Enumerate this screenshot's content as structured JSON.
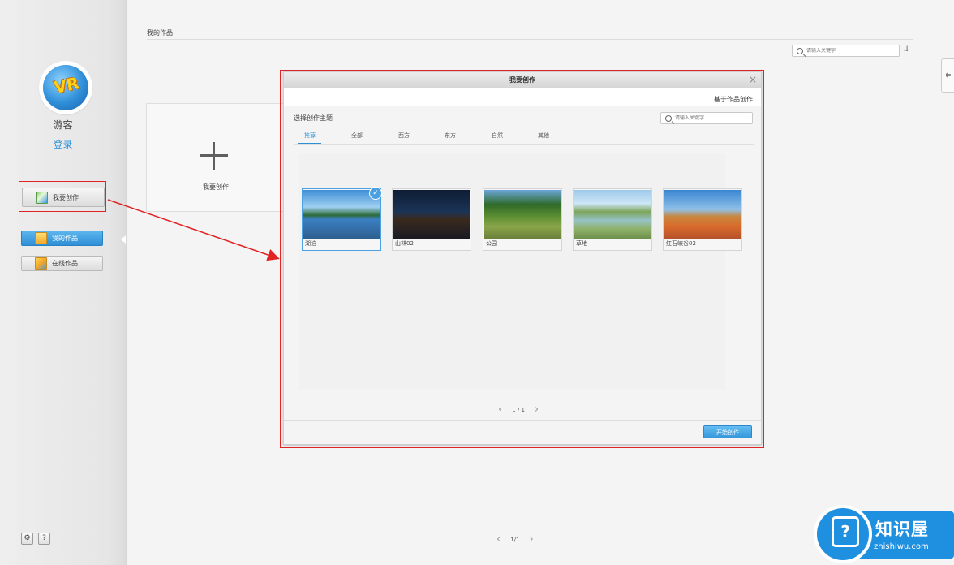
{
  "sidebar": {
    "avatar_text": "VR",
    "username": "游客",
    "login_label": "登录",
    "create_label": "我要创作",
    "nav": [
      {
        "label": "我的作品",
        "icon": "folder-icon"
      },
      {
        "label": "在线作品",
        "icon": "online-works-icon"
      }
    ],
    "settings_icon": "gear-icon",
    "help_label": "?"
  },
  "main": {
    "breadcrumb": "我的作品",
    "search_placeholder": "请输入关键字",
    "sort_icon": "sort-icon",
    "create_card_label": "我要创作",
    "pager": {
      "text": "1/1"
    }
  },
  "dialog": {
    "title": "我要创作",
    "close": "×",
    "based_on_link": "基于作品创作",
    "subtitle": "选择创作主题",
    "search_placeholder": "请输入关键字",
    "tabs": [
      "推荐",
      "全部",
      "西方",
      "东方",
      "自然",
      "其他"
    ],
    "active_tab": "推荐",
    "scenes": [
      {
        "name": "湖泊",
        "selected": true
      },
      {
        "name": "山林02",
        "selected": false
      },
      {
        "name": "公园",
        "selected": false
      },
      {
        "name": "草地",
        "selected": false
      },
      {
        "name": "红石峡谷02",
        "selected": false
      }
    ],
    "pager": {
      "text": "1 / 1"
    },
    "start_button": "开始创作"
  },
  "watermark": {
    "title": "知识屋",
    "url": "zhishiwu.com",
    "icon": "question-icon"
  },
  "colors": {
    "accent": "#2f8fd6",
    "annotation": "#e02424",
    "watermark": "#1f8fe0"
  }
}
